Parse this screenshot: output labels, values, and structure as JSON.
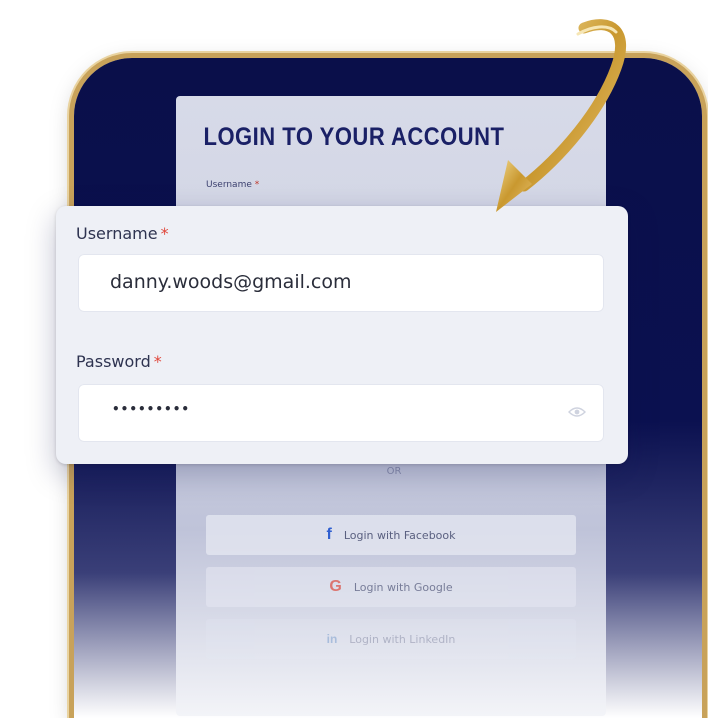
{
  "background_screen": {
    "title": "LOGIN TO YOUR ACCOUNT",
    "username_label": "Username",
    "required_mark": "*",
    "or_text": "OR",
    "social_buttons": [
      {
        "label": "Login with Facebook",
        "icon": "facebook-icon",
        "glyph": "f"
      },
      {
        "label": "Login with Google",
        "icon": "google-icon",
        "glyph": "G"
      },
      {
        "label": "Login with LinkedIn",
        "icon": "linkedin-icon",
        "glyph": "in"
      }
    ]
  },
  "form": {
    "username": {
      "label": "Username",
      "required_mark": "*",
      "value": "danny.woods@gmail.com"
    },
    "password": {
      "label": "Password",
      "required_mark": "*",
      "value": "•••••••••"
    }
  },
  "colors": {
    "frame": "#0a0f4a",
    "gold": "#c8a25a",
    "title": "#1a2066",
    "required": "#e0463a"
  }
}
